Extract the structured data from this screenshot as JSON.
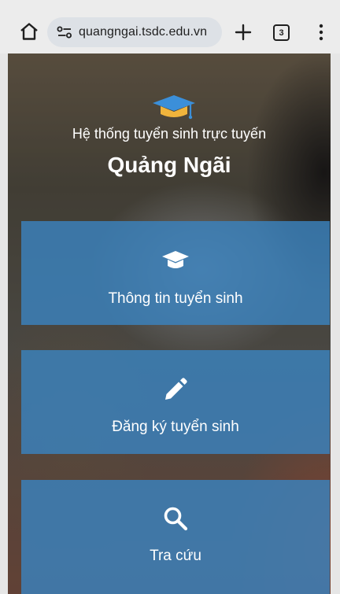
{
  "browser": {
    "url": "quangngai.tsdc.edu.vn",
    "tab_count": "3"
  },
  "hero": {
    "subtitle": "Hệ thống tuyển sinh trực tuyến",
    "title": "Quảng Ngãi"
  },
  "menu": {
    "items": [
      {
        "label": "Thông tin tuyển sinh",
        "icon": "graduation-cap-icon"
      },
      {
        "label": "Đăng ký tuyển sinh",
        "icon": "pencil-icon"
      },
      {
        "label": "Tra cứu",
        "icon": "search-icon"
      }
    ]
  },
  "colors": {
    "card": "#3a82be",
    "cap_top": "#3b8fd9",
    "cap_band": "#f0b43c"
  }
}
